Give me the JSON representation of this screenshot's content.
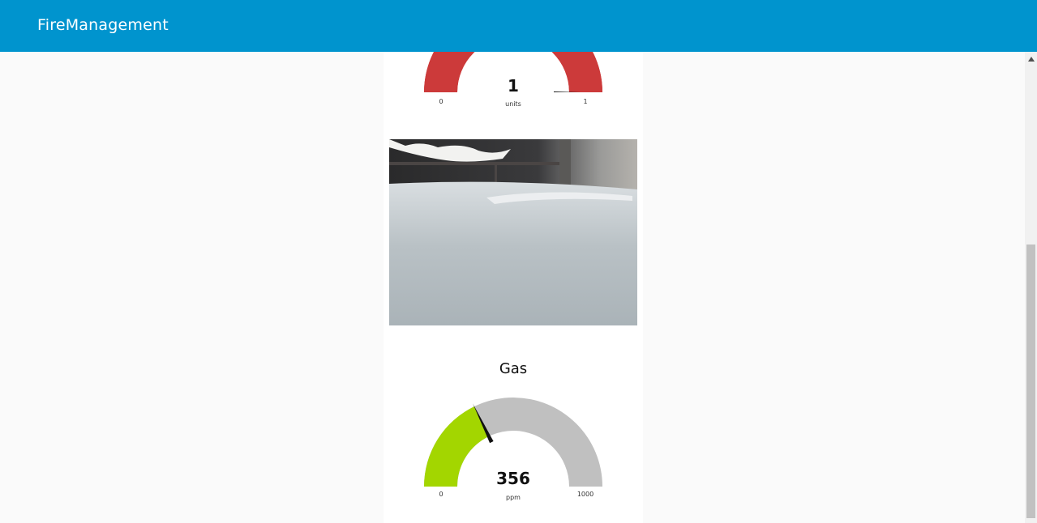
{
  "app": {
    "title": "FireManagement"
  },
  "gauges": [
    {
      "id": "top-gauge",
      "value_text": "1",
      "units": "units",
      "min_label": "0",
      "max_label": "1",
      "value": 1,
      "min": 0,
      "max": 1,
      "fill_color": "#cc3a3a",
      "track_color": "#cc3a3a"
    },
    {
      "id": "gas-gauge",
      "title": "Gas",
      "value_text": "356",
      "units": "ppm",
      "min_label": "0",
      "max_label": "1000",
      "value": 356,
      "min": 0,
      "max": 1000,
      "fill_color": "#a3d600",
      "track_color": "#c0c0c0"
    }
  ],
  "icons": {
    "scroll_up": "triangle-up-icon"
  },
  "colors": {
    "header": "#0094ce",
    "background": "#fafafa",
    "panel": "#ffffff"
  }
}
